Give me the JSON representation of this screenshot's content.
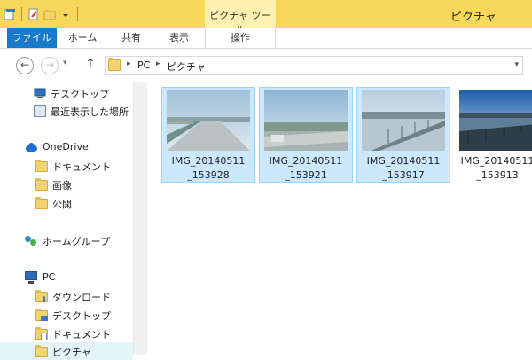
{
  "window": {
    "title": "ピクチャ",
    "context_tab_group": "ピクチャ ツール"
  },
  "ribbon": {
    "tabs": [
      {
        "label": "ファイル"
      },
      {
        "label": "ホーム"
      },
      {
        "label": "共有"
      },
      {
        "label": "表示"
      },
      {
        "label": "操作"
      }
    ]
  },
  "address": {
    "breadcrumbs": [
      "PC",
      "ピクチャ"
    ]
  },
  "nav": {
    "items": [
      {
        "label": "デスクトップ",
        "icon": "desktop-icon"
      },
      {
        "label": "最近表示した場所",
        "icon": "recent-places-icon"
      },
      {
        "label": "OneDrive",
        "icon": "onedrive-icon"
      },
      {
        "label": "ドキュメント",
        "icon": "folder-icon"
      },
      {
        "label": "画像",
        "icon": "folder-icon"
      },
      {
        "label": "公開",
        "icon": "folder-icon"
      },
      {
        "label": "ホームグループ",
        "icon": "homegroup-icon"
      },
      {
        "label": "PC",
        "icon": "pc-icon"
      },
      {
        "label": "ダウンロード",
        "icon": "downloads-folder-icon"
      },
      {
        "label": "デスクトップ",
        "icon": "desktop-folder-icon"
      },
      {
        "label": "ドキュメント",
        "icon": "documents-folder-icon"
      },
      {
        "label": "ピクチャ",
        "icon": "pictures-folder-icon"
      }
    ]
  },
  "files": [
    {
      "line1": "IMG_20140511",
      "line2": "_153928",
      "selected": true
    },
    {
      "line1": "IMG_20140511",
      "line2": "_153921",
      "selected": true
    },
    {
      "line1": "IMG_20140511",
      "line2": "_153917",
      "selected": true
    },
    {
      "line1": "IMG_20140511",
      "line2": "_153913",
      "selected": false
    }
  ],
  "colors": {
    "titlebar": "#f9d75b",
    "file_tab": "#1979ca",
    "selection": "#cce8ff",
    "selection_border": "#99d1ff"
  }
}
